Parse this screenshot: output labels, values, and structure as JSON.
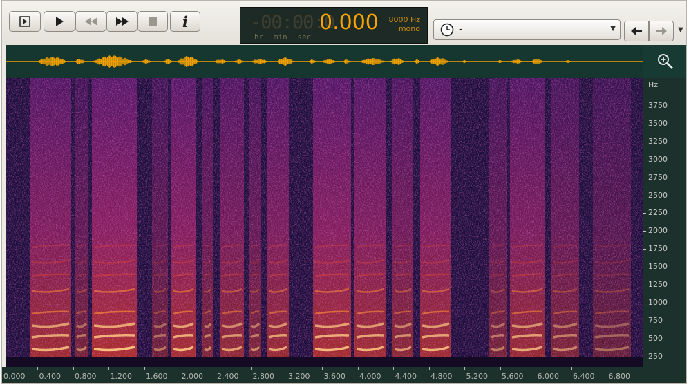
{
  "transport": {
    "buttons": [
      {
        "name": "play-selection-button",
        "icon": "play-in-box-icon"
      },
      {
        "name": "play-button",
        "icon": "play-icon"
      },
      {
        "name": "rewind-button",
        "icon": "rewind-icon"
      },
      {
        "name": "fast-forward-button",
        "icon": "fast-forward-icon"
      },
      {
        "name": "stop-button",
        "icon": "stop-icon"
      },
      {
        "name": "info-button",
        "icon": "info-icon"
      }
    ],
    "info_label": "i"
  },
  "time_display": {
    "ghost": "-00:00:0",
    "seconds": "0.000",
    "unit_hr": "hr",
    "unit_min": "min",
    "unit_sec": "sec",
    "sample_rate": "8000 Hz",
    "channels": "mono"
  },
  "history": {
    "value": "-",
    "icon": "clock-icon"
  },
  "navigation": {
    "back_icon": "arrow-left-icon",
    "forward_icon": "arrow-right-icon"
  },
  "zoom": {
    "icon": "zoom-in-icon"
  },
  "freq_axis": {
    "unit": "Hz",
    "labels": [
      "3750",
      "3500",
      "3250",
      "3000",
      "2750",
      "2500",
      "2250",
      "2000",
      "1750",
      "1500",
      "1250",
      "1000",
      "750",
      "500",
      "250"
    ]
  },
  "time_axis": {
    "labels": [
      "0.000",
      "0.400",
      "0.800",
      "1.200",
      "1.600",
      "2.000",
      "2.400",
      "2.800",
      "3.200",
      "3.600",
      "4.000",
      "4.400",
      "4.800",
      "5.200",
      "5.600",
      "6.000",
      "6.400",
      "6.800"
    ]
  },
  "colors": {
    "waveform": "#f0a000",
    "background": "#163630",
    "lcd_text": "#f5a300"
  }
}
